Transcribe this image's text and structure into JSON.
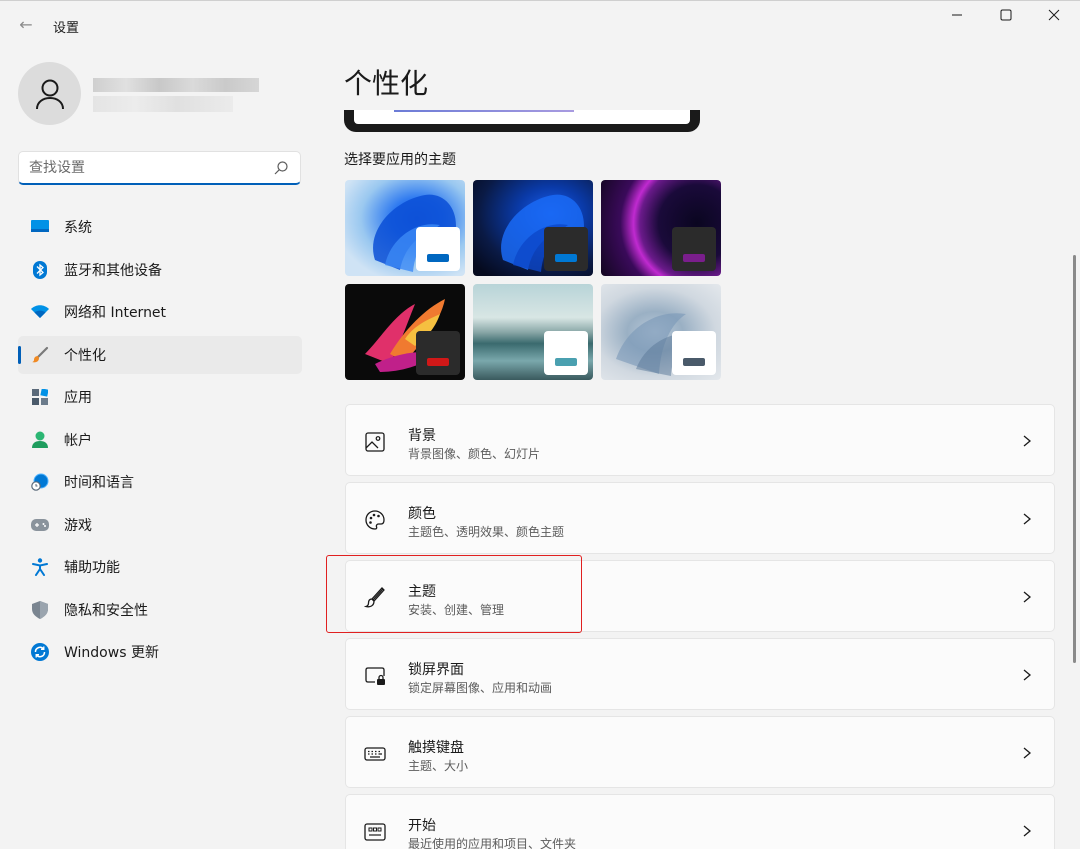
{
  "window": {
    "app_title": "设置",
    "back_label": "←",
    "minimize_label": "—",
    "maximize_label": "☐",
    "close_label": "✕"
  },
  "search": {
    "placeholder": "查找设置"
  },
  "sidebar": {
    "items": [
      {
        "label": "系统",
        "icon": "monitor-icon",
        "active": false
      },
      {
        "label": "蓝牙和其他设备",
        "icon": "bluetooth-icon",
        "active": false
      },
      {
        "label": "网络和 Internet",
        "icon": "wifi-icon",
        "active": false
      },
      {
        "label": "个性化",
        "icon": "brush-icon",
        "active": true
      },
      {
        "label": "应用",
        "icon": "apps-icon",
        "active": false
      },
      {
        "label": "帐户",
        "icon": "person-icon",
        "active": false
      },
      {
        "label": "时间和语言",
        "icon": "globe-clock-icon",
        "active": false
      },
      {
        "label": "游戏",
        "icon": "gamepad-icon",
        "active": false
      },
      {
        "label": "辅助功能",
        "icon": "accessibility-icon",
        "active": false
      },
      {
        "label": "隐私和安全性",
        "icon": "shield-icon",
        "active": false
      },
      {
        "label": "Windows 更新",
        "icon": "update-icon",
        "active": false
      }
    ]
  },
  "main": {
    "title": "个性化",
    "themes_heading": "选择要应用的主题",
    "themes": [
      {
        "name": "windows-light",
        "accent": "#0067c0",
        "badge": "#ffffff"
      },
      {
        "name": "windows-dark",
        "accent": "#0078d4",
        "badge": "#2b2b2b"
      },
      {
        "name": "glow",
        "accent": "#7a1e8c",
        "badge": "#2b2b2b"
      },
      {
        "name": "captured-motion",
        "accent": "#d01818",
        "badge": "#2b2b2b"
      },
      {
        "name": "sunrise",
        "accent": "#4aa0b0",
        "badge": "#ffffff"
      },
      {
        "name": "flow",
        "accent": "#4a5a6a",
        "badge": "#ffffff"
      }
    ],
    "cards": [
      {
        "title": "背景",
        "subtitle": "背景图像、颜色、幻灯片",
        "icon": "image-icon"
      },
      {
        "title": "颜色",
        "subtitle": "主题色、透明效果、颜色主题",
        "icon": "palette-icon"
      },
      {
        "title": "主题",
        "subtitle": "安装、创建、管理",
        "icon": "brush-icon"
      },
      {
        "title": "锁屏界面",
        "subtitle": "锁定屏幕图像、应用和动画",
        "icon": "lock-screen-icon"
      },
      {
        "title": "触摸键盘",
        "subtitle": "主题、大小",
        "icon": "keyboard-icon"
      },
      {
        "title": "开始",
        "subtitle": "最近使用的应用和项目、文件夹",
        "icon": "start-icon"
      }
    ]
  },
  "colors": {
    "accent": "#005fb8",
    "highlight_box": "#e02020"
  }
}
